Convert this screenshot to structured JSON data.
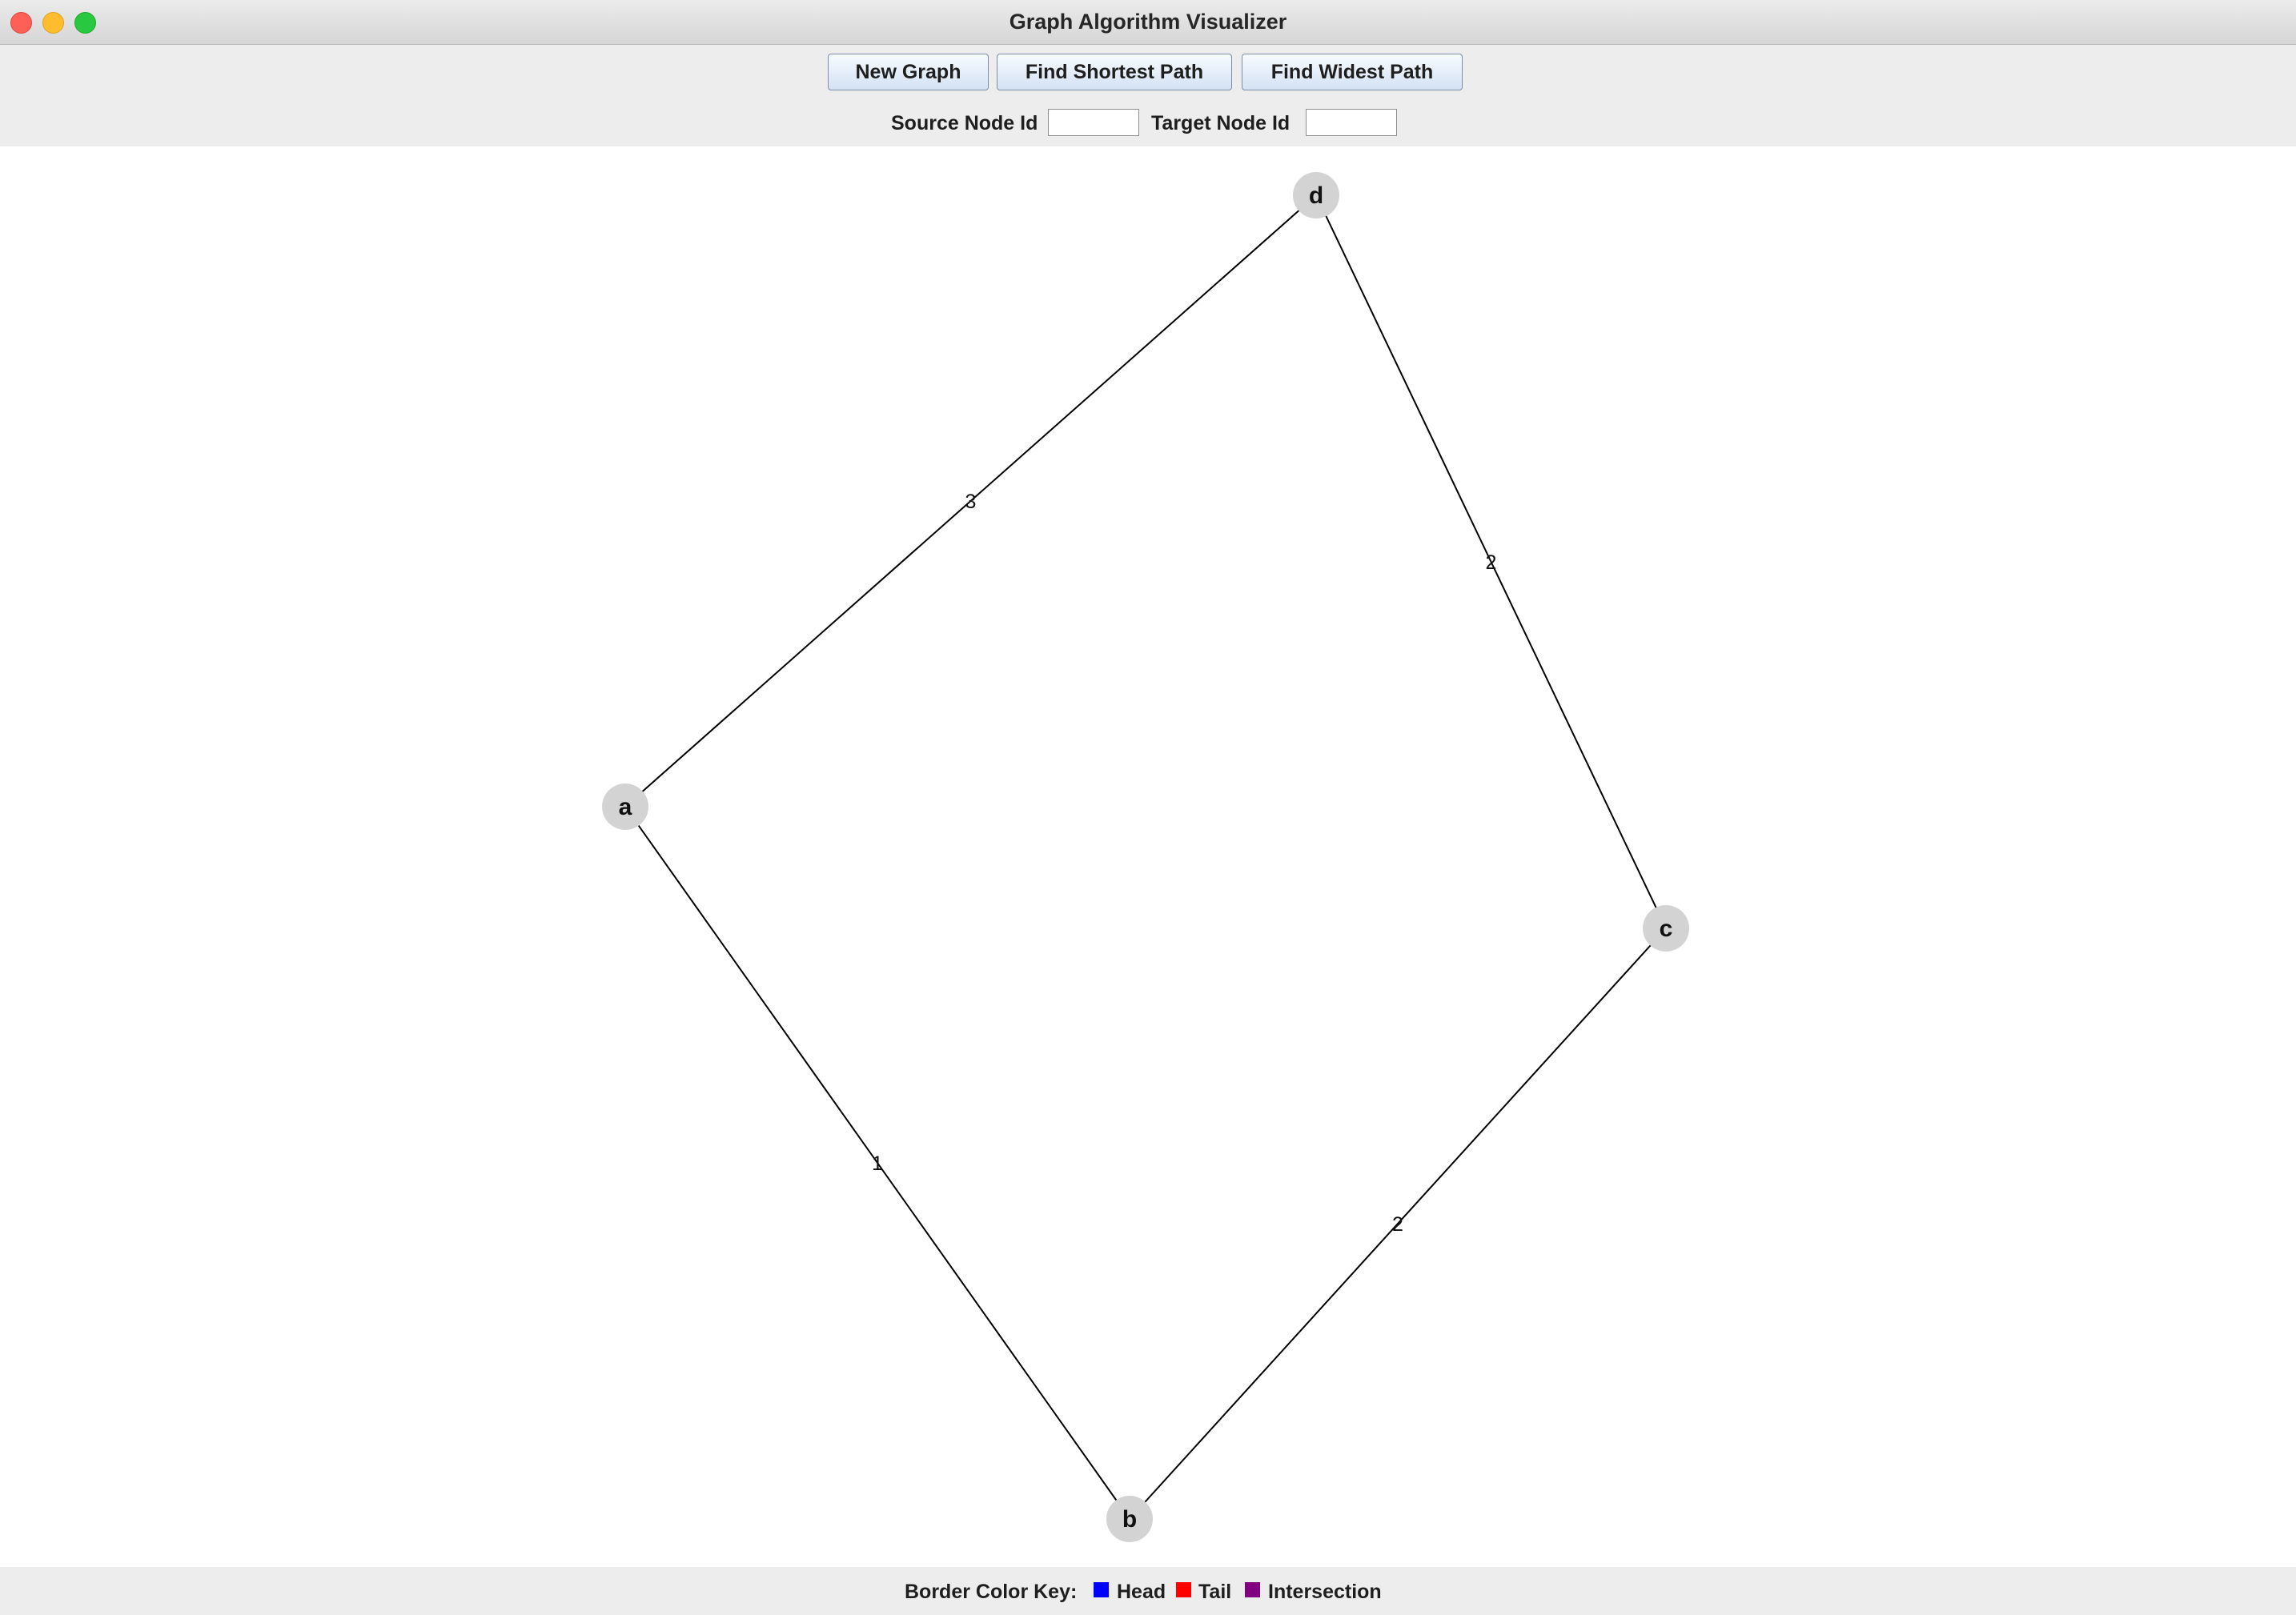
{
  "window": {
    "title": "Graph Algorithm Visualizer"
  },
  "toolbar": {
    "new_graph_label": "New Graph",
    "shortest_path_label": "Find Shortest Path",
    "widest_path_label": "Find Widest Path",
    "source_label": "Source Node Id",
    "source_value": "",
    "target_label": "Target Node Id",
    "target_value": ""
  },
  "graph": {
    "nodes": [
      {
        "id": "d",
        "label": "d"
      },
      {
        "id": "a",
        "label": "a"
      },
      {
        "id": "c",
        "label": "c"
      },
      {
        "id": "b",
        "label": "b"
      }
    ],
    "edges": [
      {
        "from": "a",
        "to": "d",
        "weight": "3"
      },
      {
        "from": "d",
        "to": "c",
        "weight": "2"
      },
      {
        "from": "a",
        "to": "b",
        "weight": "1"
      },
      {
        "from": "b",
        "to": "c",
        "weight": "2"
      }
    ],
    "node_fill": "#d3d3d3",
    "edge_color": "#000000"
  },
  "legend": {
    "title": "Border Color Key:",
    "items": [
      {
        "label": "Head",
        "color": "#0000ff"
      },
      {
        "label": "Tail",
        "color": "#ff0000"
      },
      {
        "label": "Intersection",
        "color": "#800080"
      }
    ]
  }
}
